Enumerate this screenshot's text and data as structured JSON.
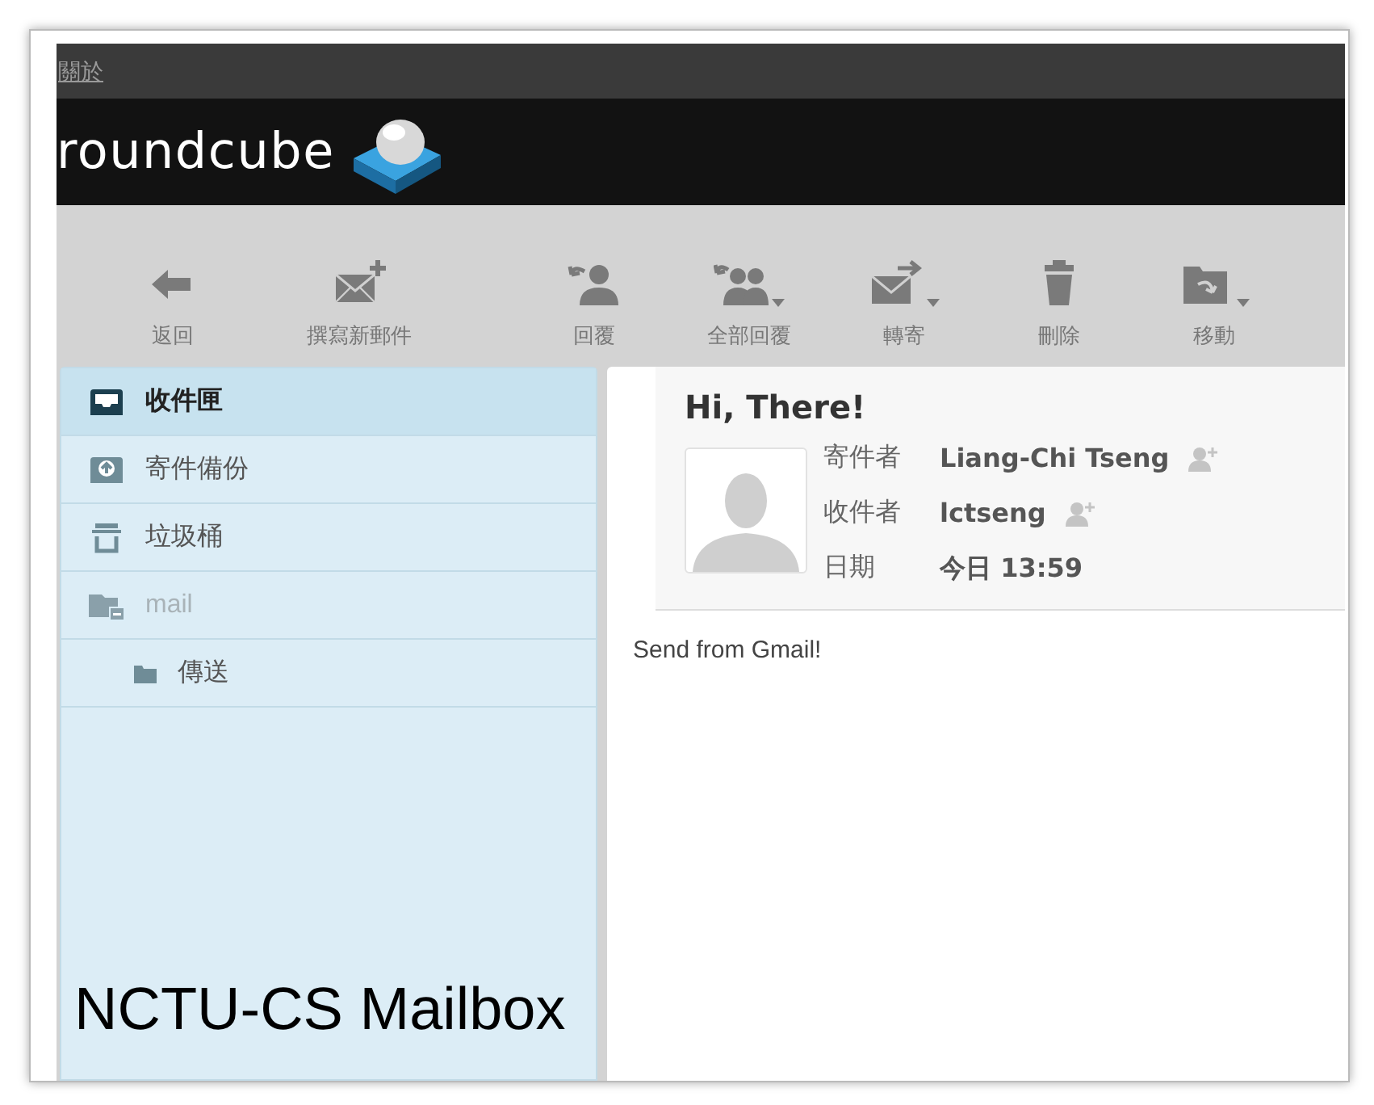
{
  "top_bar": {
    "link": "關於"
  },
  "logo": {
    "text": "roundcube"
  },
  "toolbar": [
    {
      "label": "返回",
      "kind": "back",
      "dropdown": false
    },
    {
      "label": "撰寫新郵件",
      "kind": "compose",
      "dropdown": false
    },
    {
      "label": "回覆",
      "kind": "reply",
      "dropdown": false
    },
    {
      "label": "全部回覆",
      "kind": "reply-all",
      "dropdown": true
    },
    {
      "label": "轉寄",
      "kind": "forward",
      "dropdown": true
    },
    {
      "label": "刪除",
      "kind": "delete",
      "dropdown": false
    },
    {
      "label": "移動",
      "kind": "move",
      "dropdown": true
    }
  ],
  "folders": [
    {
      "name": "收件匣",
      "kind": "inbox",
      "selected": true,
      "disabled": false
    },
    {
      "name": "寄件備份",
      "kind": "sent",
      "selected": false,
      "disabled": false
    },
    {
      "name": "垃圾桶",
      "kind": "trash",
      "selected": false,
      "disabled": false
    },
    {
      "name": "mail",
      "kind": "collapse-folder",
      "selected": false,
      "disabled": true,
      "children": [
        {
          "name": "傳送",
          "kind": "folder",
          "selected": false,
          "disabled": false
        }
      ]
    }
  ],
  "message": {
    "subject": "Hi, There!",
    "headers": [
      {
        "label": "寄件者",
        "value": "Liang-Chi Tseng",
        "add_contact": true
      },
      {
        "label": "收件者",
        "value": "lctseng",
        "add_contact": true
      },
      {
        "label": "日期",
        "value": "今日 13:59",
        "add_contact": false
      }
    ],
    "body": "Send from Gmail!"
  },
  "caption": "NCTU-CS Mailbox"
}
